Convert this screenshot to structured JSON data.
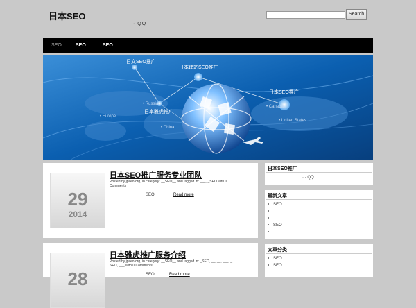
{
  "header": {
    "site_title": "日本SEO",
    "tagline": "· QQ",
    "search_placeholder": "",
    "search_button": "Search"
  },
  "nav": {
    "items": [
      {
        "label": "SEO"
      },
      {
        "label": "SEO"
      },
      {
        "label": "SEO"
      }
    ]
  },
  "banner": {
    "labels": [
      "日文SEO推广",
      "日本建站SEO推广",
      "日本SEO推广",
      "日本雅虎推广"
    ],
    "map_labels": [
      "Europe",
      "Russia",
      "China",
      "United States",
      "Canada"
    ],
    "colors": {
      "primary": "#0b5fb0",
      "deep": "#073f7e",
      "accent": "#8ec8ff"
    }
  },
  "posts": [
    {
      "title": "日本SEO推广服务专业团队",
      "meta_line1": "Posted by jpseo.org, in category: __SEO__ and tagged in: ___, _SEO with 0",
      "meta_line2": "Comments",
      "excerpt": "SEO",
      "read_more": "Read more",
      "day": "29",
      "year": "2014"
    },
    {
      "title": "日本雅虎推广服务介绍",
      "meta_line1": "Posted by jpseo.org, in category: __SEO__ and tagged in: _SEO, __, __, ___, _",
      "meta_line2": "SEO, ___ with 0 Comments",
      "excerpt": "SEO",
      "read_more": "Read more",
      "day": "28",
      "year": ""
    }
  ],
  "sidebar": {
    "widget1": {
      "title": "日本SEO推广",
      "text": "·  ·  QQ"
    },
    "widget2": {
      "title": "最新文章",
      "items": [
        "SEO",
        "",
        "",
        "SEO",
        ""
      ]
    },
    "widget3": {
      "title": "文章分类",
      "items": [
        "SEO",
        "SEO"
      ]
    }
  }
}
